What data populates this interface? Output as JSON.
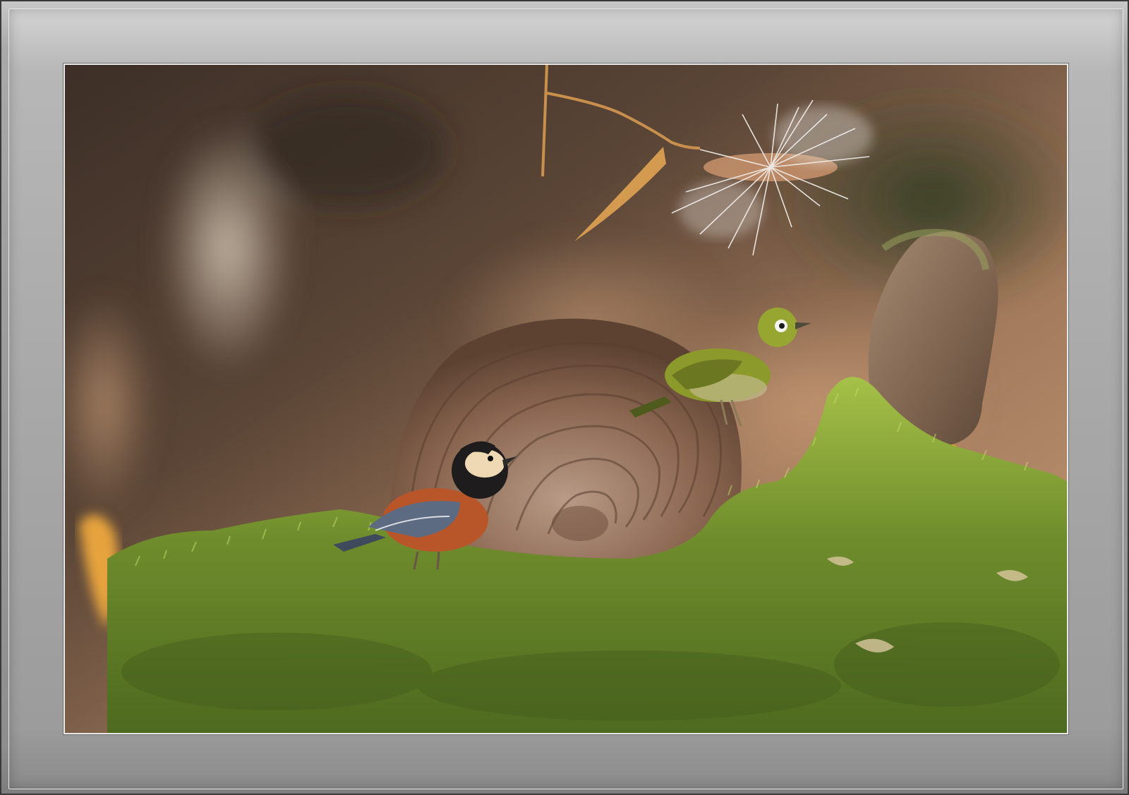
{
  "image": {
    "description_icon": "photo-icon",
    "subjects": [
      "bird-tit",
      "bird-white-eye",
      "bracket-fungus",
      "moss",
      "rock",
      "seed-fluff",
      "dry-leaf"
    ]
  },
  "palette": {
    "frame_light": "#d4d4d4",
    "frame_dark": "#8a8a8a",
    "bokeh_dark": "#4a3b30",
    "bokeh_warm": "#c59a74",
    "moss_green": "#6f8d2c",
    "moss_bright": "#a6c148",
    "fungus_brown": "#8a6650",
    "tit_orange": "#b8562a",
    "tit_blue": "#5d6b82",
    "white_eye_green": "#8b9a2a"
  }
}
